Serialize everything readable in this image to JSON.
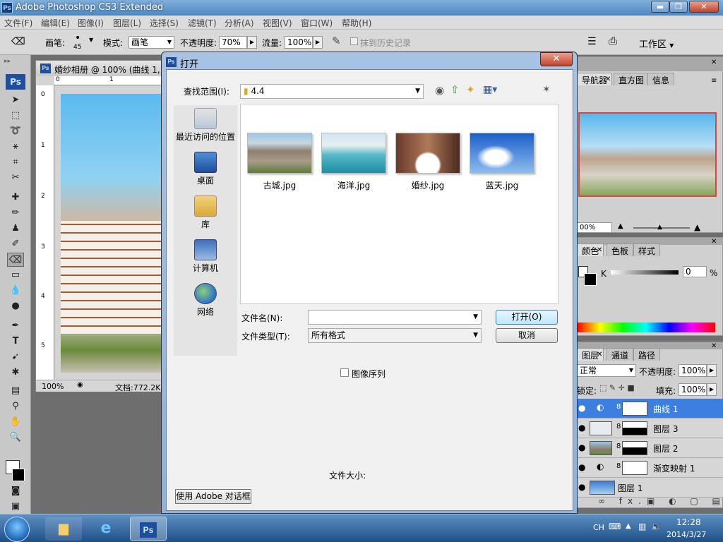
{
  "app": {
    "title": "Adobe Photoshop CS3 Extended",
    "ps_badge": "Ps",
    "win_buttons": {
      "min": "▬",
      "max": "❐",
      "close": "✕"
    }
  },
  "menu": [
    "文件(F)",
    "编辑(E)",
    "图像(I)",
    "图层(L)",
    "选择(S)",
    "滤镜(T)",
    "分析(A)",
    "视图(V)",
    "窗口(W)",
    "帮助(H)"
  ],
  "options": {
    "brush_label": "画笔:",
    "brush_size": "45",
    "mode_label": "模式:",
    "mode_value": "画笔",
    "opacity_label": "不透明度:",
    "opacity_value": "70%",
    "flow_label": "流量:",
    "flow_value": "100%",
    "erase_history": "抹到历史记录",
    "workspace": "工作区"
  },
  "document": {
    "title": "婚纱相册 @ 100% (曲线 1,",
    "ruler_top": [
      "0",
      "1"
    ],
    "ruler_left": [
      "0",
      "1",
      "2",
      "3",
      "4",
      "5"
    ],
    "zoom": "100%",
    "doc_size": "文档:772.2K"
  },
  "panels": {
    "navigator_tabs": [
      "导航器",
      "直方图",
      "信息"
    ],
    "nav_zoom": "00%",
    "color_tabs": [
      "颜色",
      "色板",
      "样式"
    ],
    "color_channel": "K",
    "color_value": "0",
    "color_unit": "%",
    "layers_tabs": [
      "图层",
      "通道",
      "路径"
    ],
    "blend_mode": "正常",
    "opacity_label": "不透明度:",
    "opacity_value": "100%",
    "lock_label": "锁定:",
    "fill_label": "填充:",
    "fill_value": "100%",
    "layers": [
      {
        "name": "曲线 1",
        "selected": true
      },
      {
        "name": "图层 3",
        "selected": false
      },
      {
        "name": "图层 2",
        "selected": false
      },
      {
        "name": "渐变映射 1",
        "selected": false
      },
      {
        "name": "图层 1",
        "selected": false
      }
    ],
    "bottom_icons": "∞ fx."
  },
  "dialog": {
    "title": "打开",
    "look_in_label": "查找范围(I):",
    "look_in_value": "4.4",
    "places": [
      {
        "label": "最近访问的位置",
        "icon": "recent-places-icon"
      },
      {
        "label": "桌面",
        "icon": "desktop-icon"
      },
      {
        "label": "库",
        "icon": "libraries-icon"
      },
      {
        "label": "计算机",
        "icon": "computer-icon"
      },
      {
        "label": "网络",
        "icon": "network-icon"
      }
    ],
    "files": [
      "古城.jpg",
      "海洋.jpg",
      "婚纱.jpg",
      "蓝天.jpg"
    ],
    "filename_label": "文件名(N):",
    "filename_value": "",
    "filetype_label": "文件类型(T):",
    "filetype_value": "所有格式",
    "open_button": "打开(O)",
    "cancel_button": "取消",
    "image_sequence": "图像序列",
    "file_size_label": "文件大小:",
    "adobe_dialog_button": "使用 Adobe 对话框"
  },
  "taskbar": {
    "lang": "CH",
    "time": "12:28",
    "date": "2014/3/27",
    "ps_label": "Ps"
  }
}
